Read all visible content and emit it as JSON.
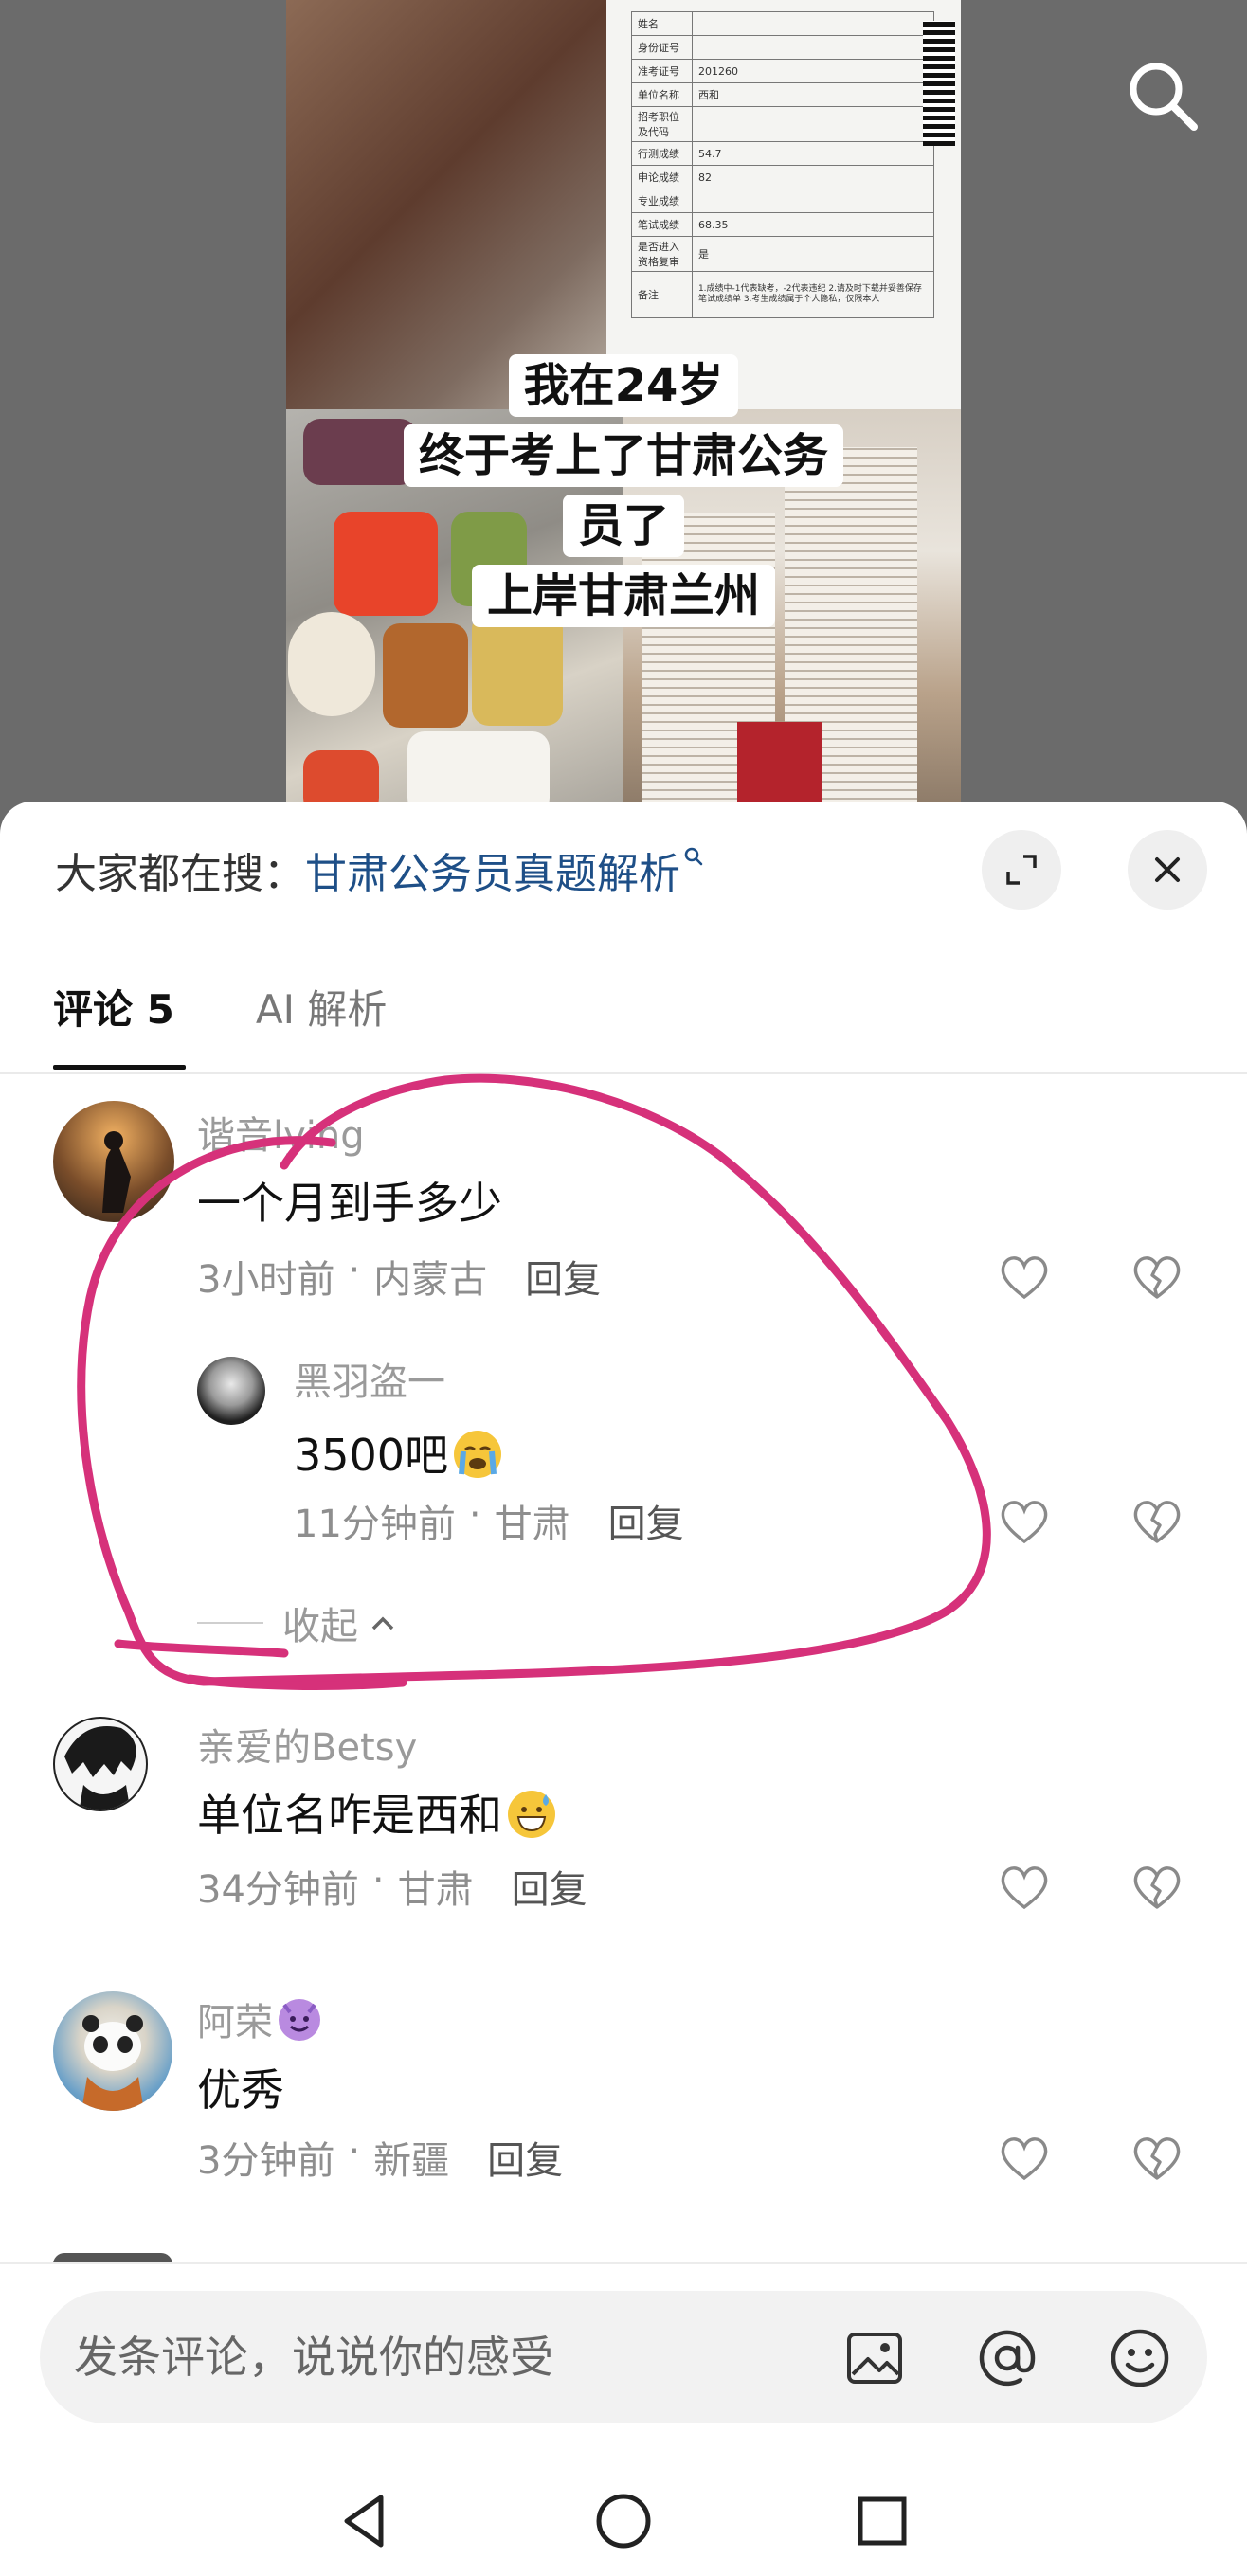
{
  "video": {
    "caption_lines": [
      "我在24岁",
      "终于考上了甘肃公务",
      "员了",
      "上岸甘肃兰州"
    ],
    "doc_rows": [
      [
        "姓名",
        ""
      ],
      [
        "身份证号",
        ""
      ],
      [
        "准考证号",
        "201260"
      ],
      [
        "单位名称",
        "西和"
      ],
      [
        "招考职位及代码",
        ""
      ],
      [
        "行测成绩",
        "54.7"
      ],
      [
        "申论成绩",
        "82"
      ],
      [
        "专业成绩",
        ""
      ],
      [
        "笔试成绩",
        "68.35"
      ],
      [
        "是否进入资格复审",
        "是"
      ],
      [
        "备注",
        "1.成绩中-1代表缺考，-2代表违纪 2.请及时下载并妥善保存笔试成绩单 3.考生成绩属于个人隐私，仅限本人"
      ]
    ]
  },
  "search": {
    "label": "大家都在搜：",
    "query": "甘肃公务员真题解析",
    "query_icon": "search-icon"
  },
  "tabs": {
    "comments": "评论 5",
    "ai": "AI 解析"
  },
  "comments": [
    {
      "user": "谐音lying",
      "text": "一个月到手多少",
      "time": "3小时前",
      "location": "内蒙古",
      "reply": "回复",
      "replies": [
        {
          "user": "黑羽盗一",
          "text": "3500吧",
          "emoji": "loudly-crying-emoji",
          "time": "11分钟前",
          "location": "甘肃",
          "reply": "回复"
        }
      ],
      "collapse": "收起"
    },
    {
      "user": "亲爱的Betsy",
      "text": "单位名咋是西和",
      "emoji": "grinning-sweat-emoji",
      "time": "34分钟前",
      "location": "甘肃",
      "reply": "回复"
    },
    {
      "user": "阿荣",
      "user_badge": "smiling-devil-emoji",
      "text": "优秀",
      "time": "3分钟前",
      "location": "新疆",
      "reply": "回复"
    }
  ],
  "input": {
    "placeholder": "发条评论，说说你的感受",
    "icons": [
      "image-icon",
      "at-icon",
      "emoji-icon"
    ]
  },
  "colors": {
    "link": "#1e4f87",
    "annotation": "#d6317a",
    "emoji": "#f6c63a"
  }
}
